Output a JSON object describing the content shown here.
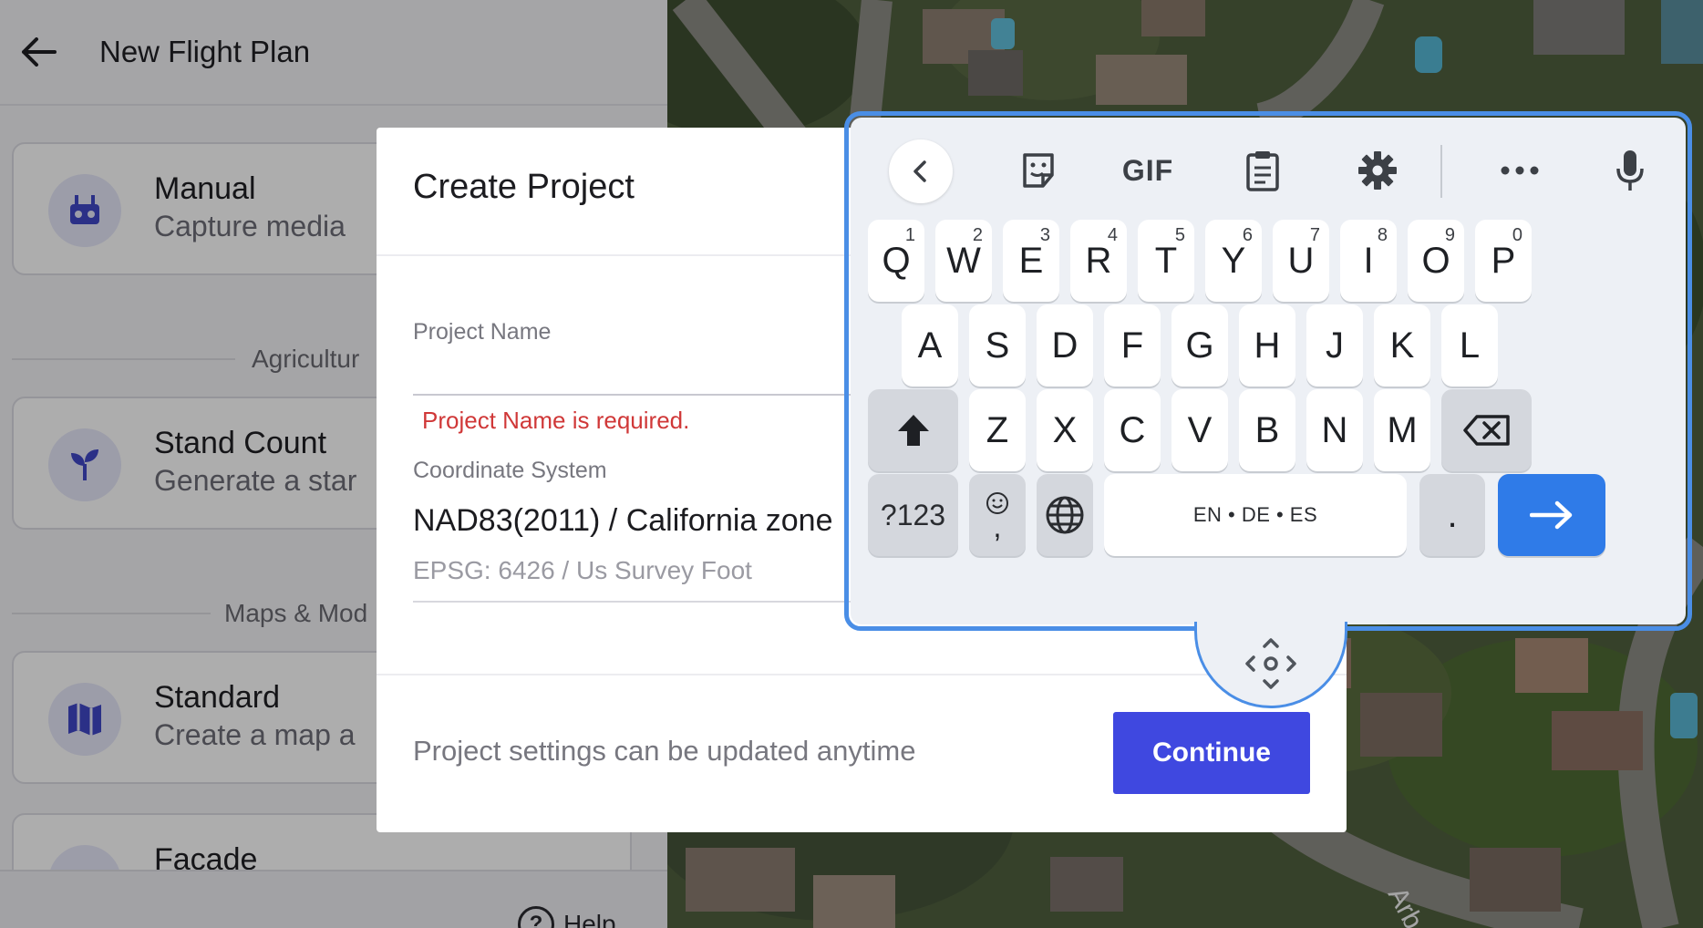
{
  "left_panel": {
    "title": "New Flight Plan",
    "cards": [
      {
        "name": "Manual",
        "description": "Capture media",
        "icon": "drone-controller-icon"
      },
      {
        "name": "Stand Count",
        "description": "Generate a star",
        "icon": "sprout-icon"
      },
      {
        "name": "Standard",
        "description": "Create a map a",
        "icon": "map-icon"
      },
      {
        "name": "Facade",
        "description": "",
        "icon": "facade-icon"
      }
    ],
    "sections": [
      "Agricultur",
      "Maps & Mod"
    ],
    "help_label": "Help"
  },
  "dialog": {
    "title": "Create Project",
    "project_name_label": "Project Name",
    "project_name_value": "",
    "project_name_error": "Project Name is required.",
    "coordinate_label": "Coordinate System",
    "coordinate_value": "NAD83(2011) / California zone",
    "coordinate_sub": "EPSG: 6426 / Us Survey Foot",
    "footer_note": "Project settings can be updated anytime",
    "continue_label": "Continue"
  },
  "keyboard": {
    "toolbar": {
      "gif_label": "GIF",
      "icons": [
        "chevron-left-icon",
        "sticker-icon",
        "gif-icon",
        "clipboard-icon",
        "gear-icon",
        "more-icon",
        "microphone-icon"
      ]
    },
    "row1": [
      {
        "key": "Q",
        "hint": "1"
      },
      {
        "key": "W",
        "hint": "2"
      },
      {
        "key": "E",
        "hint": "3"
      },
      {
        "key": "R",
        "hint": "4"
      },
      {
        "key": "T",
        "hint": "5"
      },
      {
        "key": "Y",
        "hint": "6"
      },
      {
        "key": "U",
        "hint": "7"
      },
      {
        "key": "I",
        "hint": "8"
      },
      {
        "key": "O",
        "hint": "9"
      },
      {
        "key": "P",
        "hint": "0"
      }
    ],
    "row2": [
      "A",
      "S",
      "D",
      "F",
      "G",
      "H",
      "J",
      "K",
      "L"
    ],
    "row3": [
      "Z",
      "X",
      "C",
      "V",
      "B",
      "N",
      "M"
    ],
    "symbols_label": "?123",
    "comma_label": ",",
    "space_label": "EN • DE • ES",
    "period_label": ".",
    "accent_color": "#2f7be8"
  },
  "map": {
    "street_label": "Arb"
  }
}
